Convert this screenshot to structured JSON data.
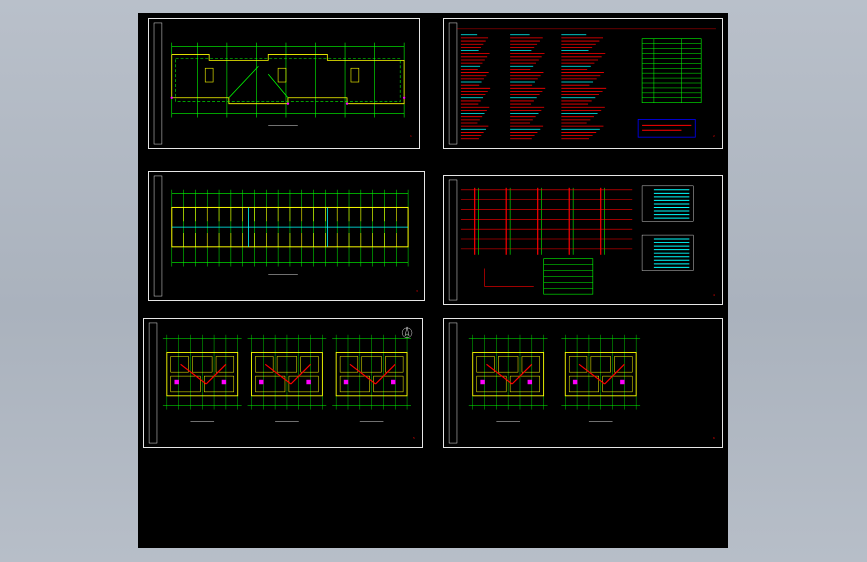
{
  "viewer": {
    "background": "#000000",
    "line_colors": {
      "wall": "#ffff00",
      "axis": "#00ff00",
      "cable": "#ff0000",
      "note": "#00ffff",
      "frame": "#e6e6e6",
      "fixture": "#ff00ff"
    }
  },
  "sheets": [
    {
      "id": "s1",
      "name": "roof-plan-sheet",
      "title": "",
      "kind": "roof-plan"
    },
    {
      "id": "s2",
      "name": "design-notes-sheet",
      "title": "",
      "kind": "notes"
    },
    {
      "id": "s3",
      "name": "floor-plan-sheet",
      "title": "",
      "kind": "floor-plan"
    },
    {
      "id": "s4",
      "name": "system-diagram-sheet",
      "title": "",
      "kind": "system"
    },
    {
      "id": "s5",
      "name": "unit-plans-sheet",
      "title": "",
      "kind": "units-3"
    },
    {
      "id": "s6",
      "name": "unit-plans-sheet-2",
      "title": "",
      "kind": "units-2"
    }
  ],
  "icons": {
    "north_arrow": "north-arrow-icon"
  }
}
